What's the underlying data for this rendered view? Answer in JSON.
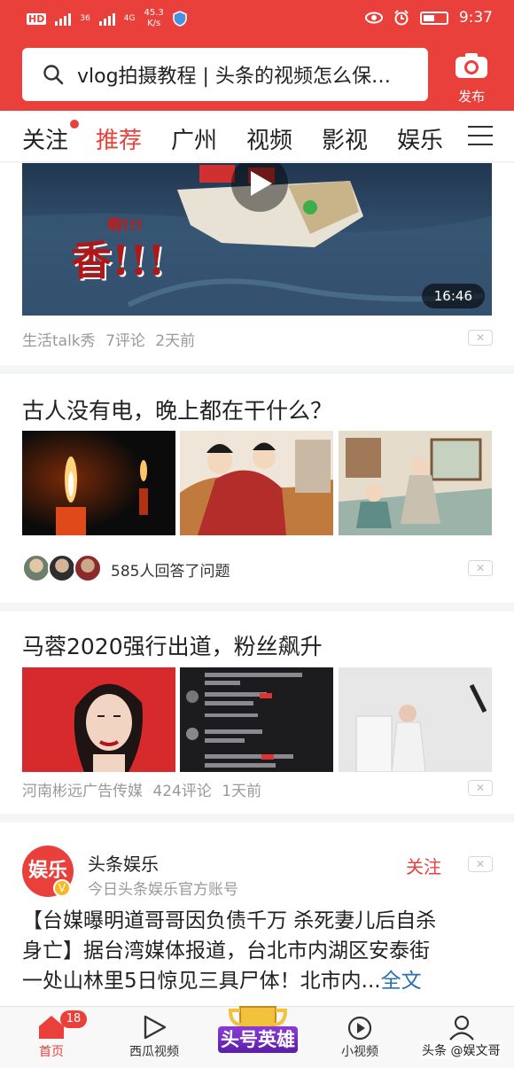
{
  "status_bar": {
    "network_left": "HD",
    "signal1": "36",
    "signal2": "4G",
    "speed_value": "45.3",
    "speed_unit": "K/s",
    "time": "9:37"
  },
  "search": {
    "text": "vlog拍摄教程 | 头条的视频怎么保…"
  },
  "publish": {
    "label": "发布"
  },
  "tabs": [
    "关注",
    "推荐",
    "广州",
    "视频",
    "影视",
    "娱乐"
  ],
  "active_tab": "推荐",
  "feed": {
    "video": {
      "overlay_text": "啊!!!",
      "duration": "16:46",
      "source": "生活talk秀",
      "comments": "7评论",
      "time": "2天前"
    },
    "question": {
      "title": "古人没有电，晚上都在干什么？",
      "answers": "585人回答了问题"
    },
    "article": {
      "title": "马蓉2020强行出道，粉丝飙升",
      "source": "河南彬远广告传媒",
      "comments": "424评论",
      "time": "1天前"
    },
    "post": {
      "avatar_text": "娱乐",
      "account": "头条娱乐",
      "subtitle": "今日头条娱乐官方账号",
      "follow": "关注",
      "line1": "【台媒曝明道哥哥因负债千万 杀死妻儿后自杀",
      "line2": "身亡】据台湾媒体报道，台北市内湖区安泰街",
      "line3": "一处山林里5日惊见三具尸体！北市内...",
      "more": "全文"
    }
  },
  "bottom_nav": {
    "home": "首页",
    "home_badge": "18",
    "xigua": "西瓜视频",
    "center": "头号英雄",
    "short": "小视频",
    "mine": "我的"
  },
  "watermark": "头条 @娱文哥",
  "colors": {
    "brand_red": "#e9403c",
    "text": "#222222",
    "meta": "#999999"
  }
}
